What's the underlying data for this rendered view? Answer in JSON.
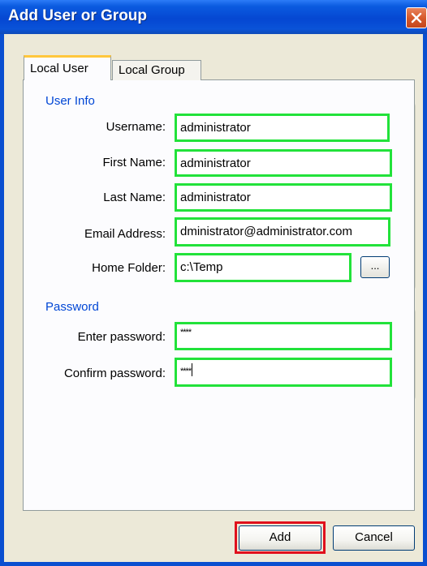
{
  "window": {
    "title": "Add User or Group"
  },
  "tabs": [
    {
      "label": "Local User",
      "active": true
    },
    {
      "label": "Local Group",
      "active": false
    }
  ],
  "user_info": {
    "legend": "User Info",
    "fields": {
      "username": {
        "label": "Username:",
        "value": "administrator"
      },
      "first_name": {
        "label": "First Name:",
        "value": "administrator"
      },
      "last_name": {
        "label": "Last Name:",
        "value": "administrator"
      },
      "email": {
        "label": "Email Address:",
        "value": "dministrator@administrator.com"
      },
      "home_folder": {
        "label": "Home Folder:",
        "value": "c:\\Temp"
      }
    },
    "browse_label": "..."
  },
  "password": {
    "legend": "Password",
    "enter": {
      "label": "Enter password:",
      "value": "****"
    },
    "confirm": {
      "label": "Confirm password:",
      "value": "****"
    }
  },
  "buttons": {
    "add": "Add",
    "cancel": "Cancel"
  },
  "colors": {
    "highlight_field": "#22e23a",
    "highlight_button": "#e0101c",
    "title_bar": "#0547d2"
  }
}
